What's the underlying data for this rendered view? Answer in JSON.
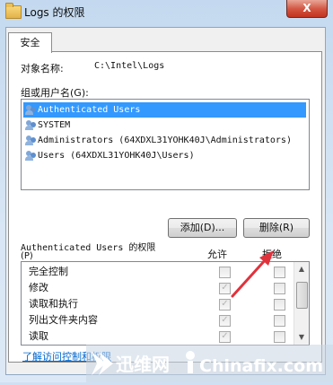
{
  "window": {
    "title": "Logs 的权限",
    "close_glyph": "X"
  },
  "tab": {
    "label": "安全"
  },
  "object": {
    "label": "对象名称:",
    "value": "C:\\Intel\\Logs"
  },
  "groups": {
    "label": "组或用户名(G):",
    "items": [
      {
        "text": "Authenticated Users",
        "selected": true
      },
      {
        "text": "SYSTEM",
        "selected": false
      },
      {
        "text": "Administrators (64XDXL31YOHK40J\\Administrators)",
        "selected": false
      },
      {
        "text": "Users (64XDXL31YOHK40J\\Users)",
        "selected": false
      }
    ]
  },
  "buttons": {
    "add": "添加(D)...",
    "remove": "删除(R)"
  },
  "permissions": {
    "title_line1": "Authenticated Users 的权限",
    "title_line2": "(P)",
    "allow_header": "允许",
    "deny_header": "拒绝",
    "rows": [
      {
        "label": "完全控制",
        "allow": false,
        "deny": false
      },
      {
        "label": "修改",
        "allow": true,
        "deny": false
      },
      {
        "label": "读取和执行",
        "allow": true,
        "deny": false
      },
      {
        "label": "列出文件夹内容",
        "allow": true,
        "deny": false
      },
      {
        "label": "读取",
        "allow": true,
        "deny": false
      }
    ]
  },
  "link": {
    "label": "了解访问控制和权限"
  },
  "watermark": {
    "left": "迅维网",
    "right": "Chinafix.com"
  },
  "colors": {
    "selection": "#3399ff",
    "link": "#0066cc",
    "arrow": "#e0323c"
  }
}
